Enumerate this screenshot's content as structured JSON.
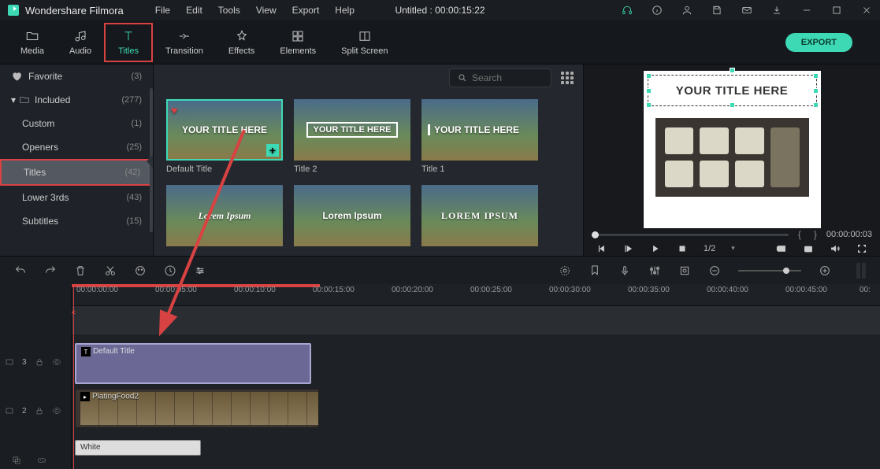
{
  "app_title": "Wondershare Filmora",
  "menu": [
    "File",
    "Edit",
    "Tools",
    "View",
    "Export",
    "Help"
  ],
  "doc_title": "Untitled : 00:00:15:22",
  "tabs": [
    {
      "id": "media",
      "label": "Media"
    },
    {
      "id": "audio",
      "label": "Audio"
    },
    {
      "id": "titles",
      "label": "Titles"
    },
    {
      "id": "transition",
      "label": "Transition"
    },
    {
      "id": "effects",
      "label": "Effects"
    },
    {
      "id": "elements",
      "label": "Elements"
    },
    {
      "id": "split",
      "label": "Split Screen"
    }
  ],
  "export_label": "EXPORT",
  "sidebar": [
    {
      "label": "Favorite",
      "count": "(3)",
      "kind": "fav"
    },
    {
      "label": "Included",
      "count": "(277)",
      "kind": "folder"
    },
    {
      "label": "Custom",
      "count": "(1)",
      "kind": "sub"
    },
    {
      "label": "Openers",
      "count": "(25)",
      "kind": "sub"
    },
    {
      "label": "Titles",
      "count": "(42)",
      "kind": "sub",
      "selected": true
    },
    {
      "label": "Lower 3rds",
      "count": "(43)",
      "kind": "sub"
    },
    {
      "label": "Subtitles",
      "count": "(15)",
      "kind": "sub"
    }
  ],
  "search_placeholder": "Search",
  "thumbs_row1": [
    {
      "text": "YOUR TITLE HERE",
      "label": "Default Title",
      "variant": "default",
      "selected": true
    },
    {
      "text": "YOUR TITLE HERE",
      "label": "Title 2",
      "variant": "boxed"
    },
    {
      "text": "YOUR TITLE HERE",
      "label": "Title 1",
      "variant": "side"
    }
  ],
  "thumbs_row2": [
    {
      "text": "Lorem Ipsum",
      "variant": "cursive"
    },
    {
      "text": "Lorem Ipsum",
      "variant": "plain"
    },
    {
      "text": "LOREM IPSUM",
      "variant": "serif"
    }
  ],
  "preview_title": "YOUR TITLE HERE",
  "preview_tc": "00:00:00:03",
  "preview_ratio": "1/2",
  "ruler_marks": [
    "00:00:00:00",
    "00:00:05:00",
    "00:00:10:00",
    "00:00:15:00",
    "00:00:20:00",
    "00:00:25:00",
    "00:00:30:00",
    "00:00:35:00",
    "00:00:40:00",
    "00:00:45:00",
    "00:"
  ],
  "tracks": {
    "t3": {
      "name": "3"
    },
    "t2": {
      "name": "2"
    }
  },
  "clips": {
    "title_clip": "Default Title",
    "video_clip": "PlatingFood2",
    "white_clip": "White"
  }
}
